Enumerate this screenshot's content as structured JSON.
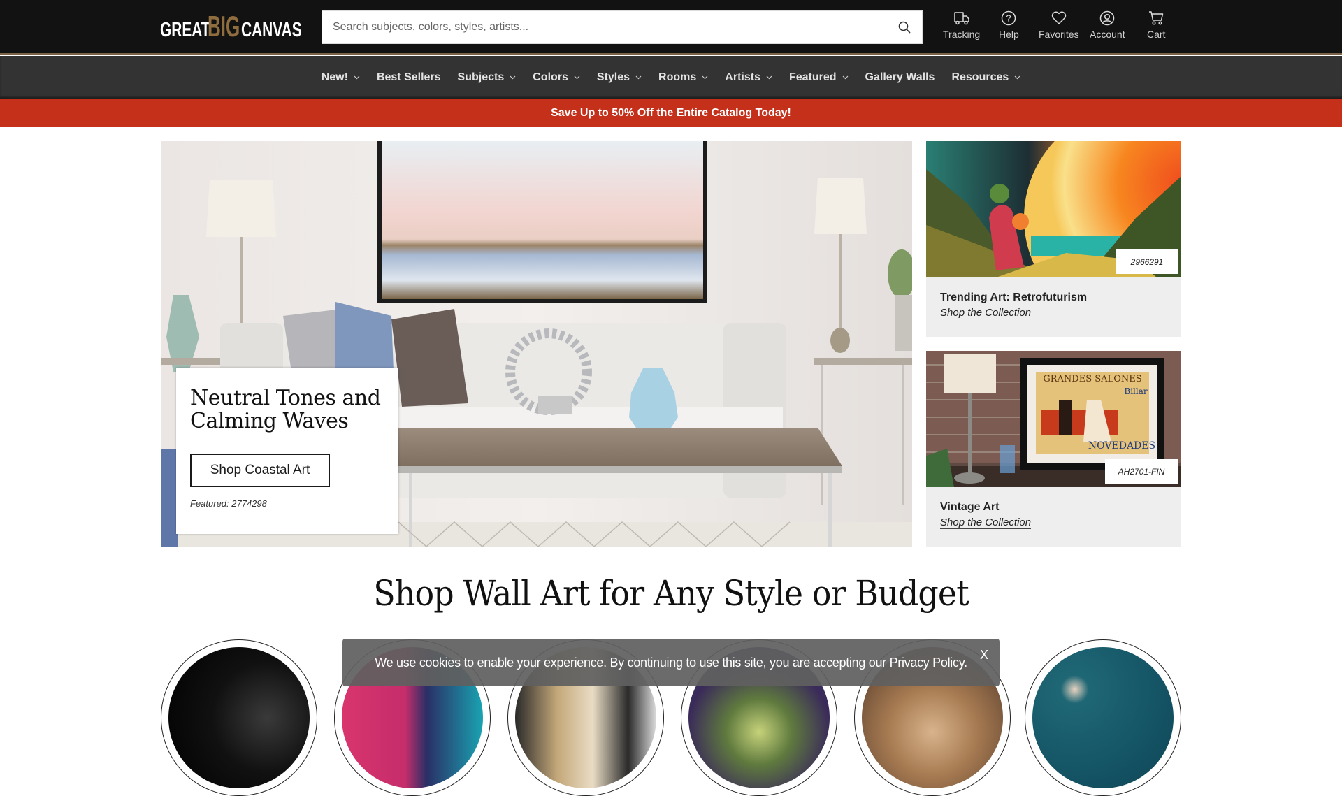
{
  "header": {
    "logo": {
      "part1": "GREAT",
      "part2": "BIG",
      "part3": "CANVAS",
      "registered": "®"
    },
    "search": {
      "placeholder": "Search subjects, colors, styles, artists...",
      "value": ""
    },
    "utilities": [
      {
        "label": "Tracking",
        "icon": "truck-icon"
      },
      {
        "label": "Help",
        "icon": "help-circle-icon"
      },
      {
        "label": "Favorites",
        "icon": "heart-icon"
      },
      {
        "label": "Account",
        "icon": "user-circle-icon"
      },
      {
        "label": "Cart",
        "icon": "cart-icon"
      }
    ]
  },
  "nav": {
    "items": [
      {
        "label": "New!",
        "dropdown": true
      },
      {
        "label": "Best Sellers",
        "dropdown": false
      },
      {
        "label": "Subjects",
        "dropdown": true
      },
      {
        "label": "Colors",
        "dropdown": true
      },
      {
        "label": "Styles",
        "dropdown": true
      },
      {
        "label": "Rooms",
        "dropdown": true
      },
      {
        "label": "Artists",
        "dropdown": true
      },
      {
        "label": "Featured",
        "dropdown": true
      },
      {
        "label": "Gallery Walls",
        "dropdown": false
      },
      {
        "label": "Resources",
        "dropdown": true
      }
    ]
  },
  "promo": {
    "text": "Save Up to 50% Off the Entire Catalog Today!"
  },
  "hero": {
    "title": "Neutral Tones and Calming Waves",
    "button_label": "Shop Coastal Art",
    "featured": "Featured: 2774298"
  },
  "side_cards": [
    {
      "sku": "2966291",
      "title": "Trending Art: Retrofuturism",
      "link": "Shop the Collection"
    },
    {
      "sku": "AH2701-FIN",
      "title": "Vintage Art",
      "link": "Shop the Collection"
    }
  ],
  "section": {
    "title": "Shop Wall Art for Any Style or Budget"
  },
  "cookie": {
    "text": "We use cookies to enable your experience. By continuing to use this site, you are accepting our ",
    "link": "Privacy Policy",
    "suffix": ".",
    "close": "X"
  },
  "colors": {
    "header_bg": "#121212",
    "nav_bg": "#333333",
    "promo_bg": "#c4301a",
    "brand_gold": "#8f6d3e",
    "card_bg": "#eeeeee"
  }
}
